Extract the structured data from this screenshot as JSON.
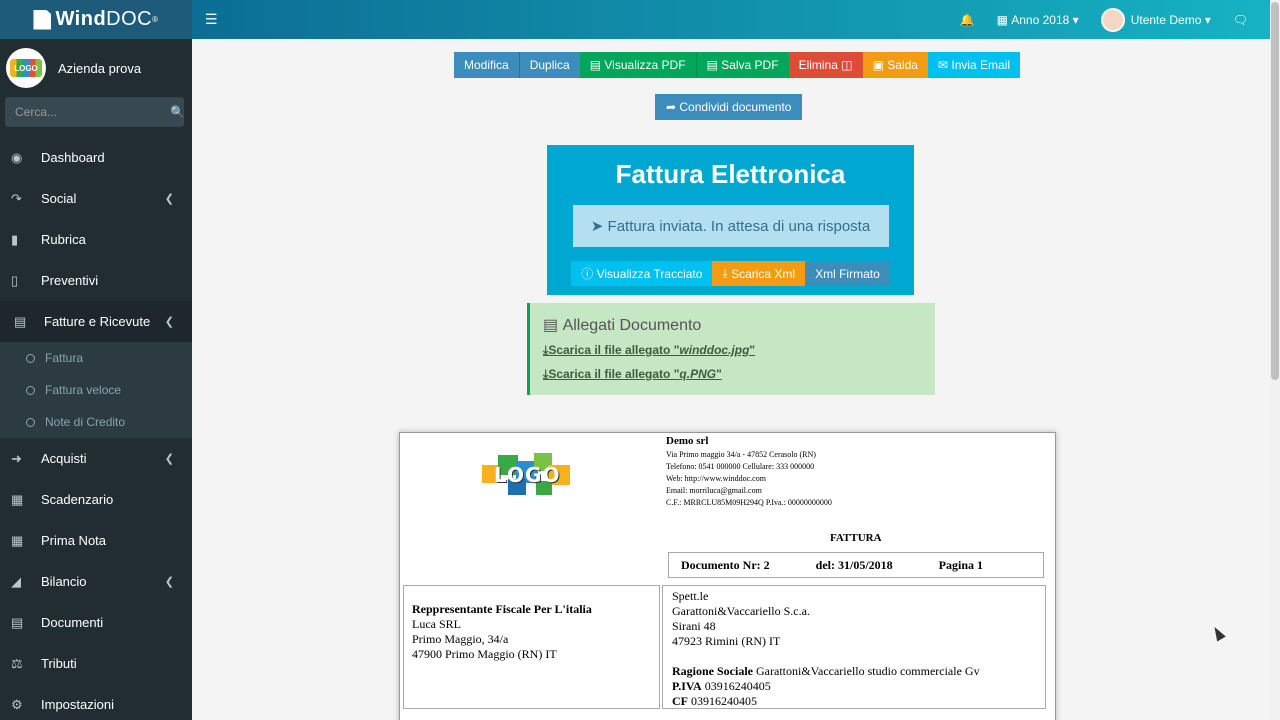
{
  "brand": {
    "name_bold": "Wind",
    "name_rest": "DOC",
    "mark": "®"
  },
  "user_panel": {
    "company": "Azienda prova",
    "logo_text": "LOGO"
  },
  "search": {
    "placeholder": "Cerca..."
  },
  "sidebar": {
    "items": [
      {
        "label": "Dashboard",
        "icon": "dashboard-icon",
        "chevron": false
      },
      {
        "label": "Social",
        "icon": "share-icon",
        "chevron": true
      },
      {
        "label": "Rubrica",
        "icon": "book-icon",
        "chevron": false
      },
      {
        "label": "Preventivi",
        "icon": "file-icon",
        "chevron": false
      },
      {
        "label": "Fatture e Ricevute",
        "icon": "file-text-icon",
        "chevron": true
      },
      {
        "label": "Acquisti",
        "icon": "sign-in-icon",
        "chevron": true
      },
      {
        "label": "Scadenzario",
        "icon": "calendar-icon",
        "chevron": false
      },
      {
        "label": "Prima Nota",
        "icon": "table-icon",
        "chevron": false
      },
      {
        "label": "Bilancio",
        "icon": "area-chart-icon",
        "chevron": true
      },
      {
        "label": "Documenti",
        "icon": "file-text-icon",
        "chevron": false
      },
      {
        "label": "Tributi",
        "icon": "balance-icon",
        "chevron": false
      },
      {
        "label": "Impostazioni",
        "icon": "gear-icon",
        "chevron": false
      }
    ],
    "submenu": [
      "Fattura",
      "Fattura veloce",
      "Note di Credito"
    ]
  },
  "header": {
    "year": "Anno 2018",
    "user": "Utente Demo"
  },
  "toolbar": {
    "modifica": "Modifica",
    "duplica": "Duplica",
    "visualizza_pdf": "Visualizza PDF",
    "salva_pdf": "Salva PDF",
    "elimina": "Elimina",
    "salda": "Salda",
    "invia_email": "Invia Email",
    "condividi": "Condividi documento"
  },
  "fattura_elettronica": {
    "title": "Fattura Elettronica",
    "status": "Fattura inviata. In attesa di una risposta",
    "visualizza": "Visualizza Tracciato",
    "scarica_xml": "Scarica Xml",
    "xml_firmato": "Xml Firmato"
  },
  "allegati": {
    "title": "Allegati Documento",
    "file1_prefix": "Scarica il file allegato \"",
    "file1_name": "winddoc.jpg",
    "file2_name": "q.PNG",
    "suffix": "\""
  },
  "document": {
    "logo_text": "LOGO",
    "company_name": "Demo srl",
    "company_lines": [
      "Via Primo maggio 34/a - 47852 Cerasolo (RN)",
      "Telefono: 0541 000000 Cellulare: 333 000000",
      "Web: http://www.winddoc.com",
      "Email: morriluca@gmail.com",
      "C.F.: MRRCLU85M09H294Q    P.Iva.: 00000000000"
    ],
    "doc_type": "FATTURA",
    "doc_nr": "Documento Nr: 2",
    "doc_date": "del: 31/05/2018",
    "doc_page": "Pagina 1",
    "left_box": {
      "title": "Reppresentante Fiscale Per L'italia",
      "lines": [
        "Luca SRL",
        "Primo Maggio, 34/a",
        "47900 Primo Maggio (RN) IT"
      ]
    },
    "right_box": {
      "lines": [
        "Spett.le",
        "Garattoni&Vaccariello S.c.a.",
        "Sirani 48",
        "47923 Rimini (RN) IT"
      ],
      "ragione_label": "Ragione Sociale",
      "ragione_value": "Garattoni&Vaccariello studio commerciale Gv",
      "piva_label": "P.IVA",
      "piva_value": "03916240405",
      "cf_label": "CF",
      "cf_value": "03916240405"
    }
  }
}
